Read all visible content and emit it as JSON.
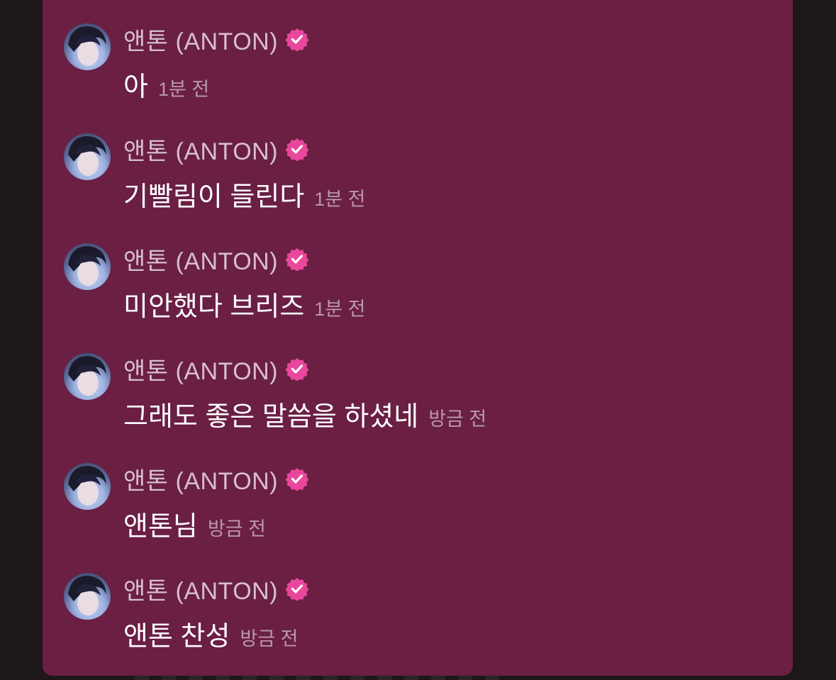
{
  "messages": [
    {
      "author": "앤톤 (ANTON)",
      "verified_icon": "verified-badge-icon",
      "text": "아",
      "time": "1분 전"
    },
    {
      "author": "앤톤 (ANTON)",
      "verified_icon": "verified-badge-icon",
      "text": "기빨림이 들린다",
      "time": "1분 전"
    },
    {
      "author": "앤톤 (ANTON)",
      "verified_icon": "verified-badge-icon",
      "text": "미안했다 브리즈",
      "time": "1분 전"
    },
    {
      "author": "앤톤 (ANTON)",
      "verified_icon": "verified-badge-icon",
      "text": "그래도 좋은 말씀을 하셨네",
      "time": "방금 전"
    },
    {
      "author": "앤톤 (ANTON)",
      "verified_icon": "verified-badge-icon",
      "text": "앤톤님",
      "time": "방금 전"
    },
    {
      "author": "앤톤 (ANTON)",
      "verified_icon": "verified-badge-icon",
      "text": "앤톤 찬성",
      "time": "방금 전"
    }
  ],
  "colors": {
    "panel_bg": "#6a1f43",
    "page_bg": "#1e1719",
    "badge": "#e9479d",
    "author_text": "#d7bfcc",
    "time_text": "#b999a9"
  }
}
